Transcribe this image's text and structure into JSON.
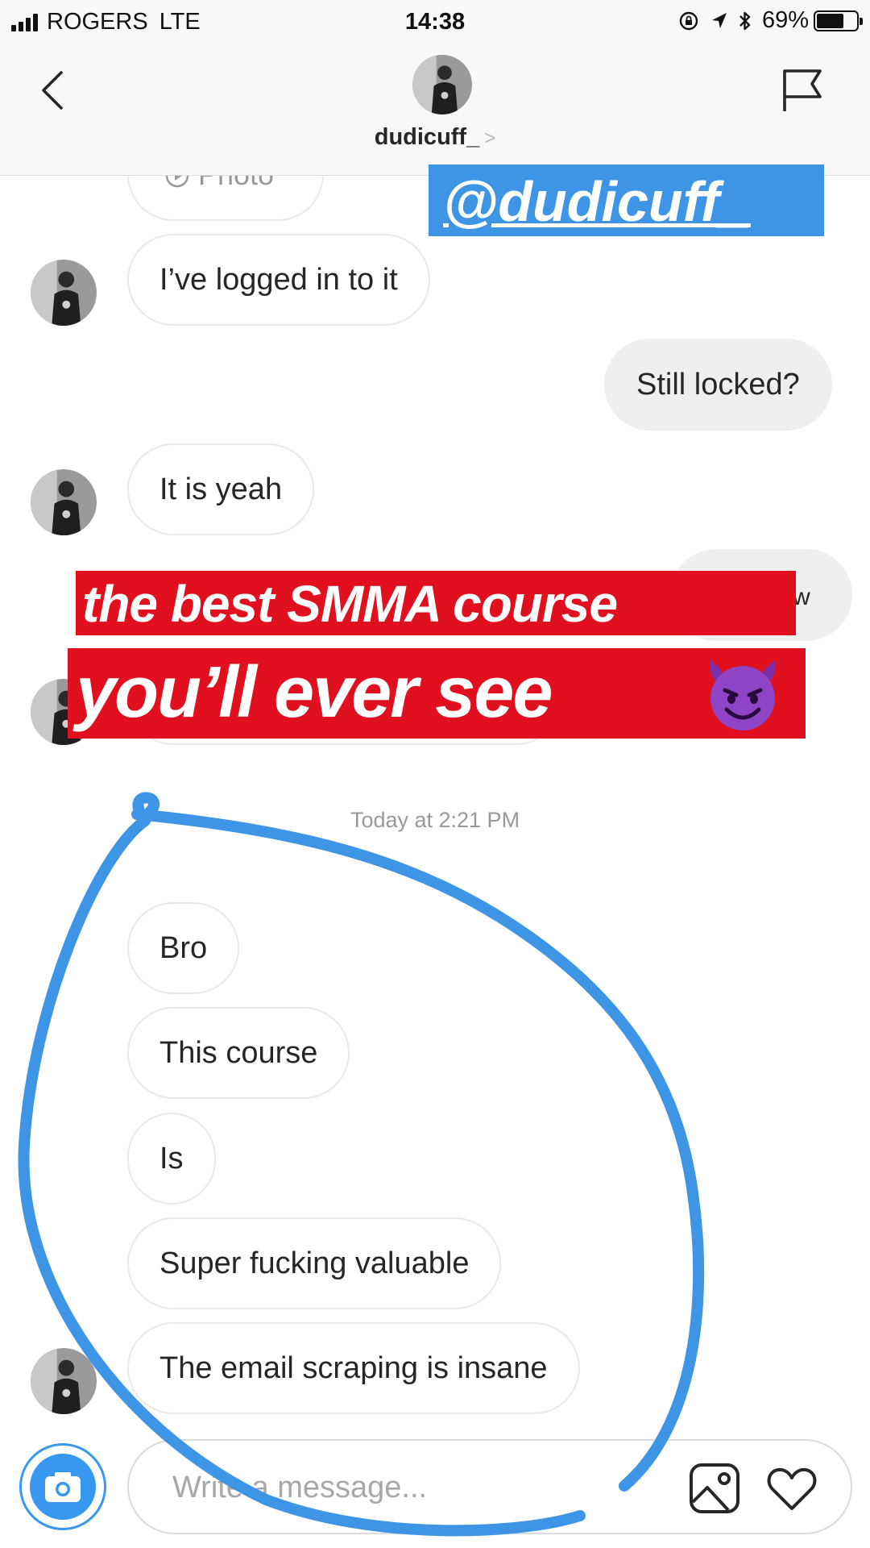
{
  "status_bar": {
    "carrier": "ROGERS",
    "network": "LTE",
    "time": "14:38",
    "battery_percent": "69%",
    "battery_level": 0.69
  },
  "header": {
    "username": "dudicuff_",
    "chevron": ">",
    "back_icon": "chevron-left-icon",
    "flag_icon": "flag-icon"
  },
  "messages": {
    "photo_label": "Photo",
    "m1": "I’ve logged in to it",
    "m2": "Still locked?",
    "m3": "It is yeah",
    "m4_visible_tail": "w",
    "timestamp": "Today at 2:21 PM",
    "m5": "Bro",
    "m6": "This course",
    "m7": "Is",
    "m8": "Super fucking valuable",
    "m9": "The email scraping is insane"
  },
  "composer": {
    "placeholder": "Write a message...",
    "camera_icon": "camera-icon",
    "gallery_icon": "image-icon",
    "heart_icon": "heart-icon"
  },
  "story_overlay": {
    "mention": "@dudicuff_",
    "caption_line1": "the best SMMA course",
    "caption_line2": "you’ll ever see",
    "emoji": "smiling-devil-emoji",
    "sticker_color": "#3e95e6",
    "caption_color": "#e0101f",
    "drawing_color": "#3e95e6"
  },
  "colors": {
    "accent": "#3897f0",
    "outgoing_bubble": "#efefef",
    "bubble_border": "#e9e9e9"
  }
}
